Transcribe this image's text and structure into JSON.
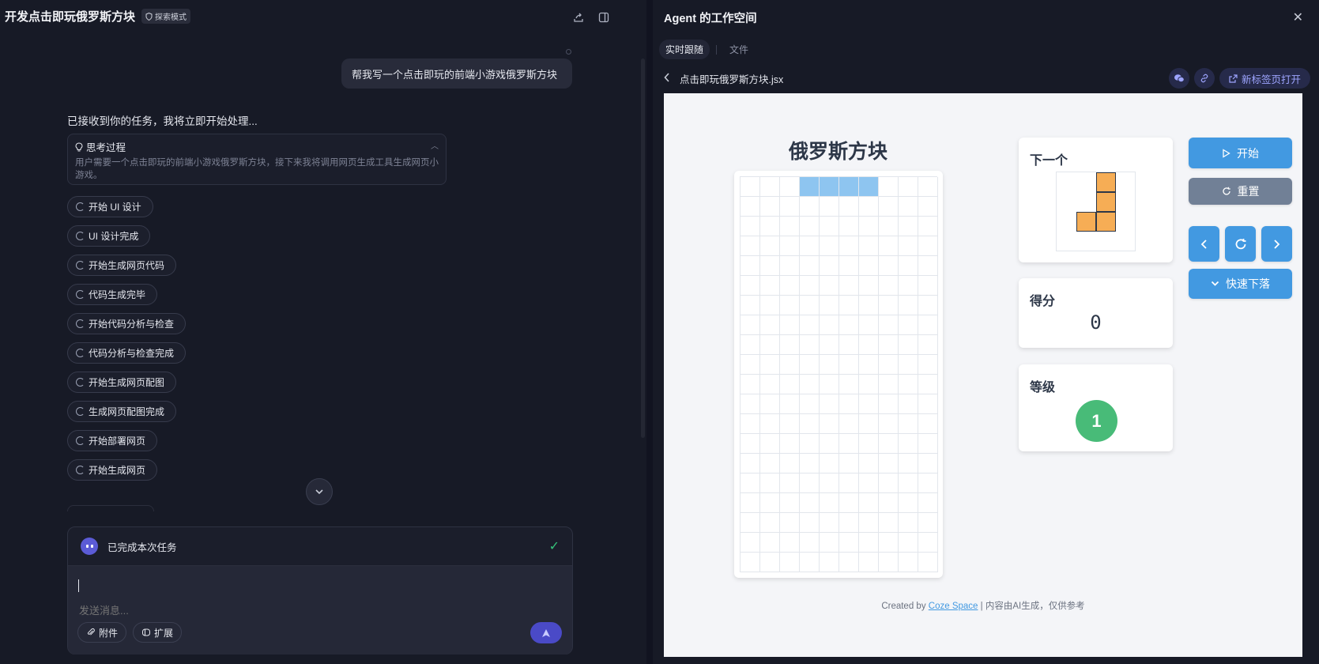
{
  "chat": {
    "title": "开发点击即玩俄罗斯方块",
    "mode_badge": "探索模式",
    "user_message": "帮我写一个点击即玩的前端小游戏俄罗斯方块",
    "ack": "已接收到你的任务，我将立即开始处理...",
    "thinking": {
      "title": "思考过程",
      "body": "用户需要一个点击即玩的前端小游戏俄罗斯方块，接下来我将调用网页生成工具生成网页小游戏。"
    },
    "steps": [
      "开始 UI 设计",
      "UI 设计完成",
      "开始生成网页代码",
      "代码生成完毕",
      "开始代码分析与检查",
      "代码分析与检查完成",
      "开始生成网页配图",
      "生成网页配图完成",
      "开始部署网页",
      "开始生成网页"
    ],
    "done_label": "已完成本次任务",
    "input_placeholder": "发送消息...",
    "attach_label": "附件",
    "extend_label": "扩展"
  },
  "workspace": {
    "title": "Agent 的工作空间",
    "tabs": [
      "实时跟随",
      "文件"
    ],
    "active_tab": 0,
    "file_name": "点击即玩俄罗斯方块.jsx",
    "open_new_tab": "新标签页打开"
  },
  "game": {
    "title": "俄罗斯方块",
    "next_label": "下一个",
    "score_label": "得分",
    "score": "0",
    "level_label": "等级",
    "level": "1",
    "start_label": "开始",
    "reset_label": "重置",
    "drop_label": "快速下落",
    "board": {
      "cols": 10,
      "rows": 20,
      "filled": [
        [
          0,
          3
        ],
        [
          0,
          4
        ],
        [
          0,
          5
        ],
        [
          0,
          6
        ]
      ]
    },
    "next_piece": [
      [
        0,
        1
      ],
      [
        1,
        1
      ],
      [
        2,
        0
      ],
      [
        2,
        1
      ]
    ],
    "colors": {
      "active_piece": "#8ec5f0",
      "next_piece": "#f6ad55",
      "primary": "#4299e1",
      "level_badge": "#48bb78"
    }
  },
  "footer": {
    "prefix": "Created by",
    "link": "Coze Space",
    "suffix": "| 内容由AI生成，仅供参考"
  }
}
